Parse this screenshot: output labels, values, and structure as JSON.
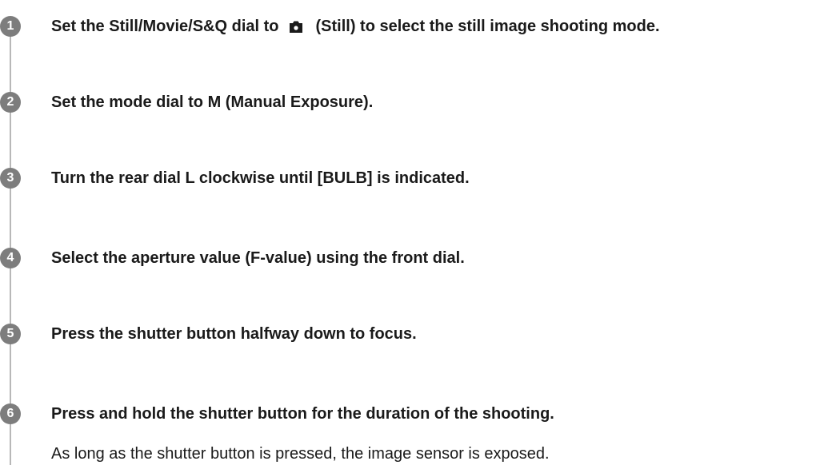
{
  "steps": [
    {
      "number": "1",
      "before_icon": "Set the Still/Movie/S&Q dial to",
      "icon": "camera-icon",
      "after_icon": "(Still) to select the still image shooting mode."
    },
    {
      "number": "2",
      "text": "Set the mode dial to M (Manual Exposure)."
    },
    {
      "number": "3",
      "text": "Turn the rear dial L clockwise until [BULB] is indicated."
    },
    {
      "number": "4",
      "text": "Select the aperture value (F-value) using the front dial."
    },
    {
      "number": "5",
      "text": "Press the shutter button halfway down to focus."
    },
    {
      "number": "6",
      "text": "Press and hold the shutter button for the duration of the shooting.",
      "note": "As long as the shutter button is pressed, the image sensor is exposed."
    }
  ],
  "colors": {
    "step_badge": "#7d7d7d",
    "timeline": "#b8b8b8",
    "text": "#1a1a1a"
  }
}
